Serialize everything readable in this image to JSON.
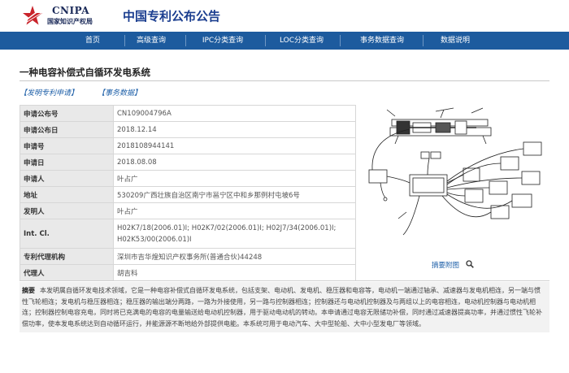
{
  "header": {
    "logo_text": "CNIPA",
    "logo_subtitle": "国家知识产权局",
    "site_title": "中国专利公布公告"
  },
  "nav": {
    "items": [
      "首页",
      "高级查询",
      "IPC分类查询",
      "LOC分类查询",
      "事务数据查询",
      "数据说明"
    ]
  },
  "patent": {
    "title": "一种电容补偿式自循环发电系统",
    "tabs": [
      "【发明专利申请】",
      "【事务数据】"
    ],
    "fields": [
      {
        "label": "申请公布号",
        "value": "CN109004796A"
      },
      {
        "label": "申请公布日",
        "value": "2018.12.14"
      },
      {
        "label": "申请号",
        "value": "2018108944141"
      },
      {
        "label": "申请日",
        "value": "2018.08.08"
      },
      {
        "label": "申请人",
        "value": "叶占广"
      },
      {
        "label": "地址",
        "value": "530209广西壮族自治区南宁市邕宁区中和乡那例村屯坡6号"
      },
      {
        "label": "发明人",
        "value": "叶占广"
      },
      {
        "label": "Int. Cl.",
        "value": "H02K7/18(2006.01)I; H02K7/02(2006.01)I; H02J7/34(2006.01)I; H02K53/00(2006.01)I"
      },
      {
        "label": "专利代理机构",
        "value": "深圳市吉华煌知识产权事务所(普通合伙)44248"
      },
      {
        "label": "代理人",
        "value": "胡吉科"
      }
    ],
    "drawing_caption": "摘要附图",
    "abstract_label": "摘要",
    "abstract_text": "本发明属自循环发电技术领域，它是一种电容补偿式自循环发电系统，包括支架、电动机、发电机、稳压器和电容等，电动机一端通过轴承、减速器与发电机相连，另一端与惯性飞轮相连；发电机与稳压器相连；稳压器的输出端分两路，一路为外接使用，另一路与控制器相连；控制器还与电动机控制器及与两组以上的电容相连，电动机控制器与电动机相连；控制器控制电容充电，同时将已充满电的电容的电量输送给电动机控制器，用于驱动电动机的转动。本申请通过电容无限储功补偿，同时通过减速器提高功率，并通过惯性飞轮补偿功率，使本发电系统达到自动循环运行，并能源源不断地给外部提供电能。本系统可用于电动汽车、大中型轮船、大中小型发电厂等领域。"
  }
}
